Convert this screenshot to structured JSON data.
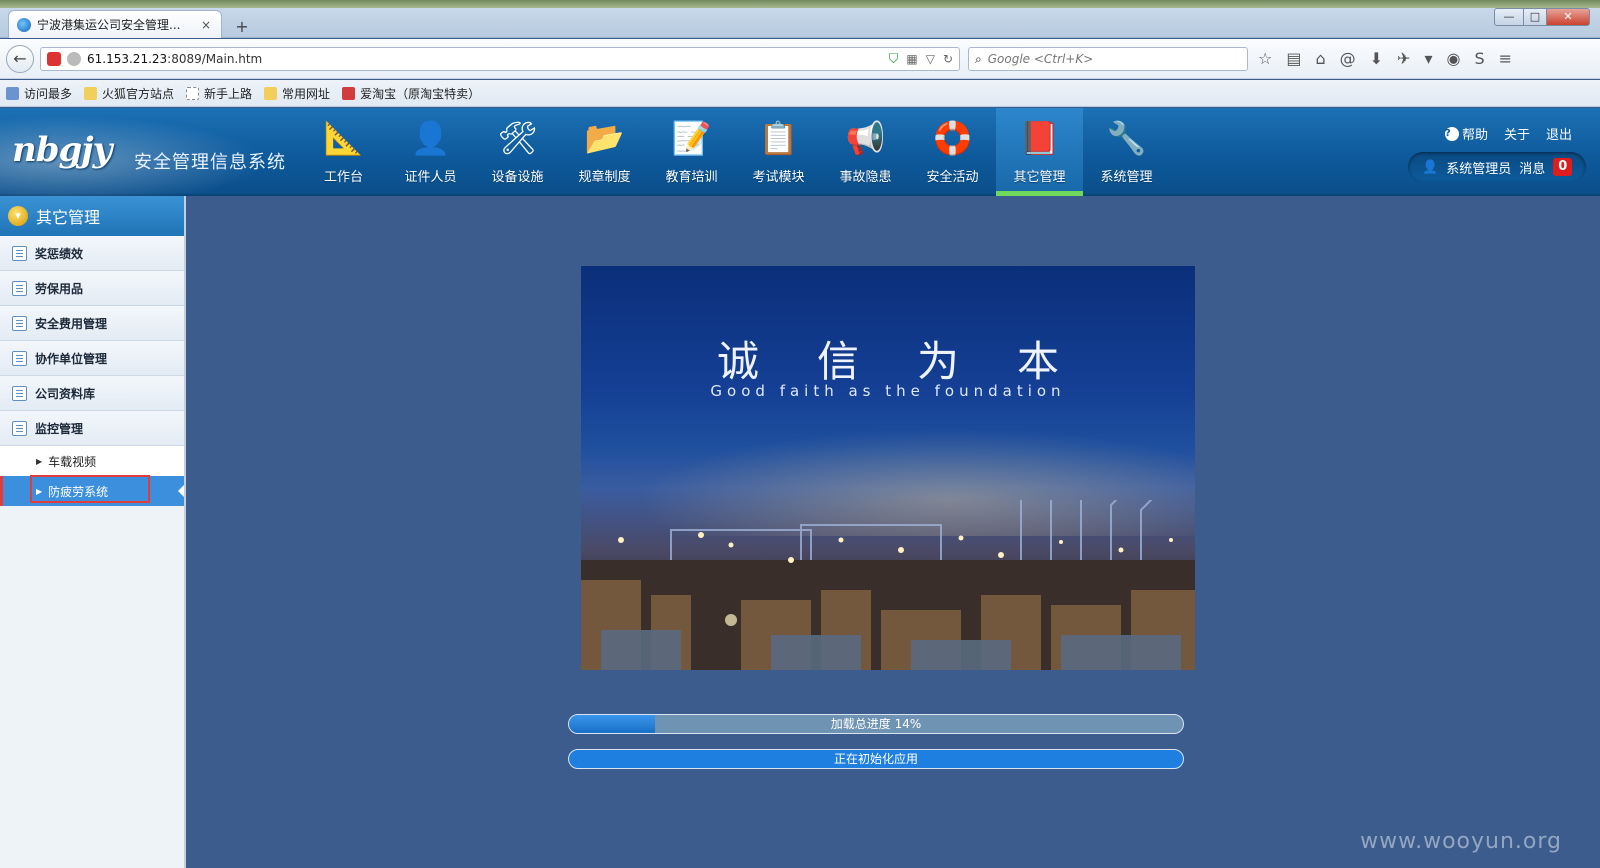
{
  "browser": {
    "tab_title": "宁波港集运公司安全管理...",
    "tab_close": "×",
    "new_tab": "+",
    "url_host": "61.153.21.23",
    "url_rest": ":8089/Main.htm",
    "search_placeholder": "Google <Ctrl+K>",
    "window_controls": {
      "minimize": "—",
      "maximize": "□",
      "close": "✕"
    },
    "bookmarks": [
      {
        "label": "访问最多",
        "icon": "most-visited-icon"
      },
      {
        "label": "火狐官方站点",
        "icon": "folder-icon"
      },
      {
        "label": "新手上路",
        "icon": "page-icon"
      },
      {
        "label": "常用网址",
        "icon": "folder-icon"
      },
      {
        "label": "爱淘宝（原淘宝特卖）",
        "icon": "taobao-icon"
      }
    ]
  },
  "header": {
    "logo": "nbgjy",
    "app_title": "安全管理信息系统",
    "nav": [
      {
        "label": "工作台",
        "icon": "workbench-icon",
        "glyph": "📐",
        "active": false
      },
      {
        "label": "证件人员",
        "icon": "person-icon",
        "glyph": "👤",
        "active": false
      },
      {
        "label": "设备设施",
        "icon": "tools-icon",
        "glyph": "🛠",
        "active": false
      },
      {
        "label": "规章制度",
        "icon": "folder-download-icon",
        "glyph": "📂",
        "active": false
      },
      {
        "label": "教育培训",
        "icon": "document-pen-icon",
        "glyph": "📝",
        "active": false
      },
      {
        "label": "考试模块",
        "icon": "exam-certificate-icon",
        "glyph": "📋",
        "active": false
      },
      {
        "label": "事故隐患",
        "icon": "megaphone-icon",
        "glyph": "📢",
        "active": false
      },
      {
        "label": "安全活动",
        "icon": "lifebuoy-icon",
        "glyph": "🛟",
        "active": false
      },
      {
        "label": "其它管理",
        "icon": "book-icon",
        "glyph": "📕",
        "active": true
      },
      {
        "label": "系统管理",
        "icon": "wrench-icon",
        "glyph": "🔧",
        "active": false
      }
    ],
    "links": {
      "help": "帮助",
      "about": "关于",
      "logout": "退出"
    },
    "user_name": "系统管理员",
    "messages_label": "消息",
    "message_count": "0"
  },
  "sidebar": {
    "title": "其它管理",
    "items": [
      {
        "label": "奖惩绩效"
      },
      {
        "label": "劳保用品"
      },
      {
        "label": "安全费用管理"
      },
      {
        "label": "协作单位管理"
      },
      {
        "label": "公司资料库"
      },
      {
        "label": "监控管理"
      }
    ],
    "sub_items": [
      {
        "label": "车载视频",
        "active": false
      },
      {
        "label": "防疲劳系统",
        "active": true
      }
    ]
  },
  "main": {
    "splash_title": "诚信为本",
    "splash_subtitle": "Good faith as the foundation",
    "progress_total_label": "加载总进度 14%",
    "progress_total_value": 0.14,
    "progress_init_label": "正在初始化应用"
  },
  "watermark": "www.wooyun.org",
  "colors": {
    "header_blue": "#0e5a9c",
    "active_green": "#6fd85d",
    "content_bg": "#3b5c8c",
    "progress_blue": "#1e7fe0",
    "highlight_red": "#e23b3b"
  }
}
